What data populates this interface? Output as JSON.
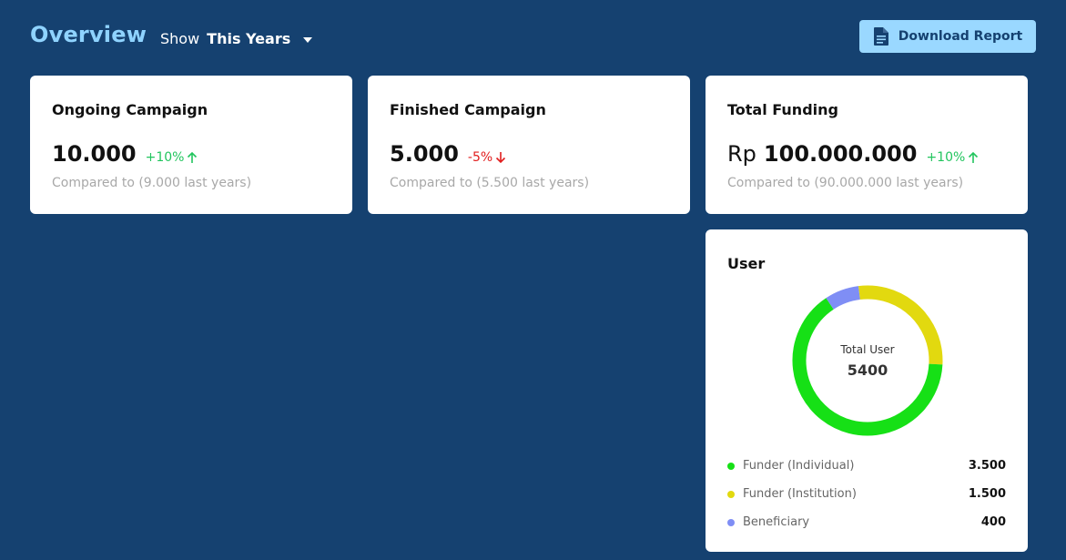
{
  "header": {
    "title": "Overview",
    "show_label": "Show",
    "show_value": "This Years",
    "download_label": "Download Report"
  },
  "cards": [
    {
      "title": "Ongoing Campaign",
      "prefix": "",
      "value": "10.000",
      "delta": "+10%",
      "trend": "up",
      "compare": "Compared to (9.000 last years)"
    },
    {
      "title": "Finished Campaign",
      "prefix": "",
      "value": "5.000",
      "delta": "-5%",
      "trend": "down",
      "compare": "Compared to (5.500 last years)"
    },
    {
      "title": "Total Funding",
      "prefix": "Rp",
      "value": "100.000.000",
      "delta": "+10%",
      "trend": "up",
      "compare": "Compared to (90.000.000 last years)"
    }
  ],
  "user_card": {
    "title": "User",
    "center_label": "Total User",
    "center_value": "5400",
    "legend": [
      {
        "label": "Funder (Individual)",
        "value": "3.500",
        "amount": 3500,
        "color": "#16e016"
      },
      {
        "label": "Funder (Institution)",
        "value": "1.500",
        "amount": 1500,
        "color": "#e2d90f"
      },
      {
        "label": "Beneficiary",
        "value": "400",
        "amount": 400,
        "color": "#7f8ef5"
      }
    ]
  },
  "colors": {
    "background": "#154170",
    "title": "#8fd3ff",
    "button_bg": "#9ad8ff",
    "positive": "#22c55e",
    "negative": "#e11d1d"
  }
}
